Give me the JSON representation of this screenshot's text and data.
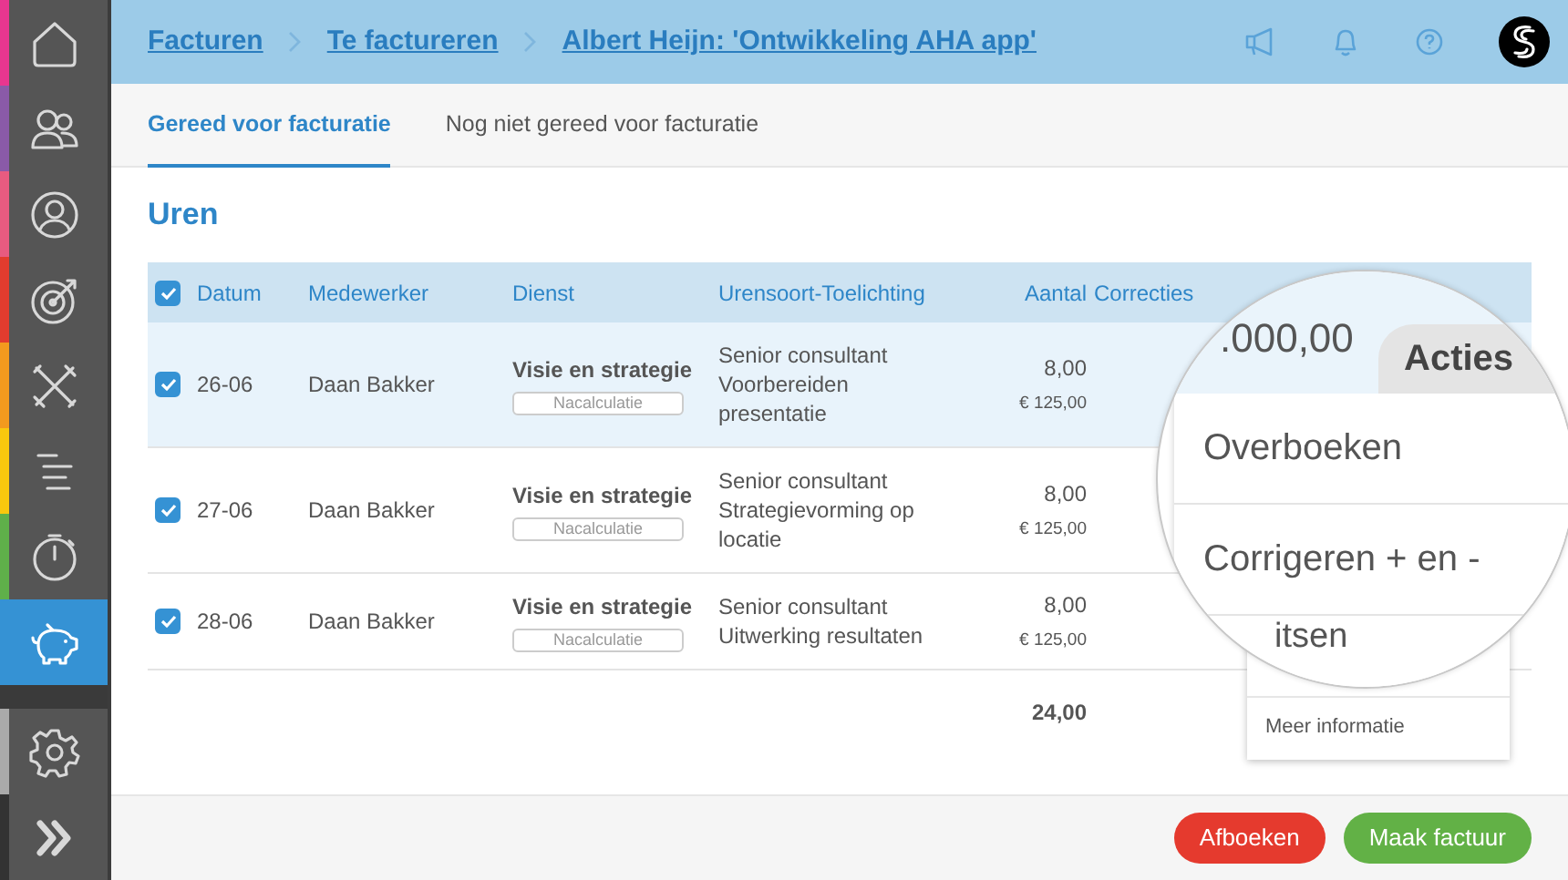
{
  "sidebar": {
    "items": [
      {
        "color": "#e8368f",
        "selected": false
      },
      {
        "color": "#8a5aa8",
        "selected": false
      },
      {
        "color": "#e85b80",
        "selected": false
      },
      {
        "color": "#e23c2e",
        "selected": false
      },
      {
        "color": "#f39a1e",
        "selected": false
      },
      {
        "color": "#f9c80e",
        "selected": false
      },
      {
        "color": "#5fb04a",
        "selected": false
      },
      {
        "color": "#3592d4",
        "selected": true
      },
      {
        "color": "#aaaaaa",
        "selected": false
      },
      {
        "color": "#333333",
        "selected": false
      }
    ]
  },
  "breadcrumbs": [
    "Facturen",
    "Te factureren",
    "Albert Heijn: 'Ontwikkeling AHA app'"
  ],
  "tabs": [
    {
      "label": "Gereed voor facturatie",
      "selected": true
    },
    {
      "label": "Nog niet gereed voor facturatie",
      "selected": false
    }
  ],
  "section_title": "Uren",
  "table": {
    "all_checked": true,
    "columns": [
      "Datum",
      "Medewerker",
      "Dienst",
      "Urensoort-Toelichting",
      "Aantal",
      "Correcties"
    ],
    "rows": [
      {
        "checked": true,
        "highlighted": true,
        "date": "26-06",
        "employee": "Daan Bakker",
        "service": "Visie en strategie",
        "tag": "Nacalculatie",
        "description": "Senior consultant Voorbereiden presentatie",
        "amount": "8,00",
        "rate": "€ 125,00"
      },
      {
        "checked": true,
        "highlighted": false,
        "date": "27-06",
        "employee": "Daan Bakker",
        "service": "Visie en strategie",
        "tag": "Nacalculatie",
        "description": "Senior consultant Strategievorming op locatie",
        "amount": "8,00",
        "rate": "€ 125,00"
      },
      {
        "checked": true,
        "highlighted": false,
        "date": "28-06",
        "employee": "Daan Bakker",
        "service": "Visie en strategie",
        "tag": "Nacalculatie",
        "description": "Senior consultant Uitwerking resultaten",
        "amount": "8,00",
        "rate": "€ 125,00"
      }
    ],
    "total": "24,00"
  },
  "dropdown": {
    "items": [
      "Meer informatie"
    ]
  },
  "magnifier": {
    "amount": ".000,00",
    "button": "Acties",
    "items": [
      "Overboeken",
      "Corrigeren + en -",
      "itsen"
    ]
  },
  "buttons": [
    {
      "label": "Afboeken",
      "kind": "danger"
    },
    {
      "label": "Maak factuur",
      "kind": "success"
    }
  ]
}
